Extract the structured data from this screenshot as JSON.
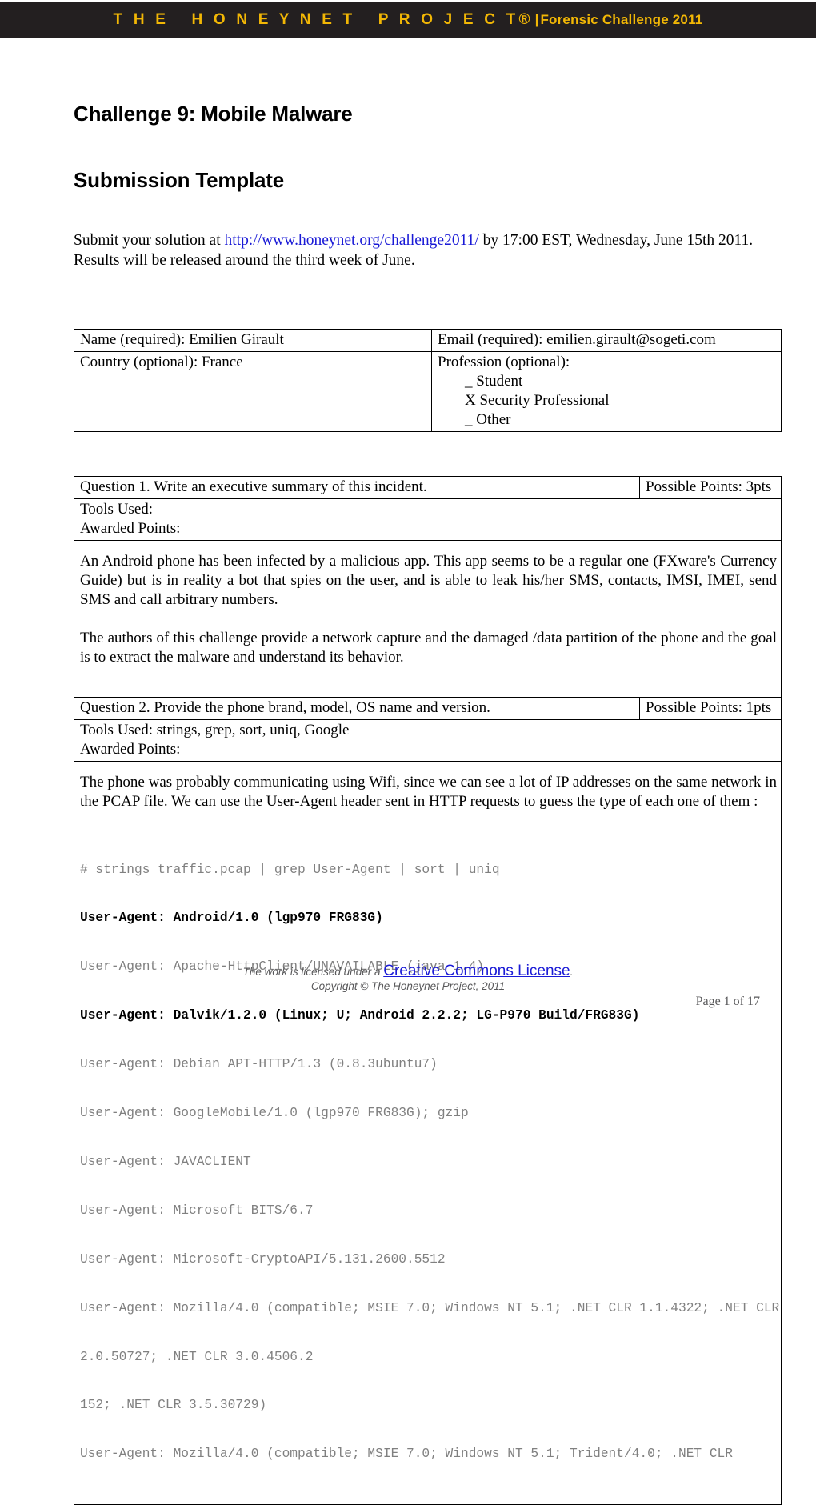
{
  "banner": {
    "title": "T H E   H O N E Y N E T   P R O J E C T®",
    "separator": "|",
    "subtitle": "Forensic Challenge 2011"
  },
  "headings": {
    "challenge_title": "Challenge 9: Mobile Malware",
    "document_type": "Submission Template"
  },
  "intro": {
    "before_link": "Submit your solution at ",
    "link_text": "http://www.honeynet.org/challenge2011/",
    "after_link": " by 17:00 EST, Wednesday, June 15th 2011. Results will be released around the third week of June."
  },
  "identity": {
    "name_label": "Name (required):",
    "name_value": "Emilien Girault",
    "email_label": "Email (required):",
    "email_value": "emilien.girault@sogeti.com",
    "country_label": "Country (optional):",
    "country_value": "France",
    "profession_label": "Profession (optional):",
    "profession_options": [
      "_ Student",
      "X Security Professional",
      "_ Other"
    ]
  },
  "questions": [
    {
      "heading": "Question 1. Write an executive summary of this incident.",
      "points_label": "Possible Points: 3pts",
      "tools_label": "Tools Used:",
      "tools_value": "",
      "awarded_label": "Awarded Points:",
      "awarded_value": "",
      "answer_paragraphs": [
        "An Android phone has been infected by a malicious app. This app seems to be a regular one (FXware's Currency Guide) but is in reality a bot that spies on the user, and is able to leak his/her SMS, contacts, IMSI, IMEI, send SMS and call arbitrary numbers.",
        "The authors of this challenge provide a network capture and the damaged /data partition of the phone and the goal is to extract the malware and understand its behavior."
      ]
    },
    {
      "heading": "Question 2. Provide the phone brand, model, OS name and version.",
      "points_label": "Possible Points: 1pts",
      "tools_label": "Tools Used:",
      "tools_value": " strings, grep, sort, uniq, Google",
      "awarded_label": "Awarded Points:",
      "awarded_value": "",
      "answer_paragraphs": [
        "The phone was probably communicating using Wifi, since we can see a lot of IP addresses on the same network in the PCAP file. We can use the User-Agent header sent in HTTP requests to guess the type of each one of them :"
      ],
      "console_lines": [
        {
          "text": "# strings traffic.pcap | grep User-Agent | sort | uniq",
          "style": "dim"
        },
        {
          "text": "User-Agent: Android/1.0 (lgp970 FRG83G)",
          "style": "hit"
        },
        {
          "text": "User-Agent: Apache-HttpClient/UNAVAILABLE (java 1.4)",
          "style": "dim"
        },
        {
          "text": "User-Agent: Dalvik/1.2.0 (Linux; U; Android 2.2.2; LG-P970 Build/FRG83G)",
          "style": "hit"
        },
        {
          "text": "User-Agent: Debian APT-HTTP/1.3 (0.8.3ubuntu7)",
          "style": "dim"
        },
        {
          "text": "User-Agent: GoogleMobile/1.0 (lgp970 FRG83G); gzip",
          "style": "dim"
        },
        {
          "text": "User-Agent: JAVACLIENT",
          "style": "dim"
        },
        {
          "text": "User-Agent: Microsoft BITS/6.7",
          "style": "dim"
        },
        {
          "text": "User-Agent: Microsoft-CryptoAPI/5.131.2600.5512",
          "style": "dim"
        },
        {
          "text": "User-Agent: Mozilla/4.0 (compatible; MSIE 7.0; Windows NT 5.1; .NET CLR 1.1.4322; .NET CLR",
          "style": "dim"
        },
        {
          "text": "2.0.50727; .NET CLR 3.0.4506.2",
          "style": "dim"
        },
        {
          "text": "152; .NET CLR 3.5.30729)",
          "style": "dim"
        },
        {
          "text": "User-Agent: Mozilla/4.0 (compatible; MSIE 7.0; Windows NT 5.1; Trident/4.0; .NET CLR",
          "style": "dim"
        }
      ]
    }
  ],
  "footer": {
    "license_prefix": "The work is licensed under a ",
    "license_link": "Creative Commons License",
    "license_suffix": ".",
    "copyright": "Copyright © The Honeynet Project, 2011",
    "page_number": "Page 1 of 17"
  },
  "colors": {
    "banner_background": "#231f20",
    "banner_text": "#f2b705",
    "link": "#1a1ad6",
    "console_dim": "#808080",
    "footer_text": "#58585a"
  }
}
